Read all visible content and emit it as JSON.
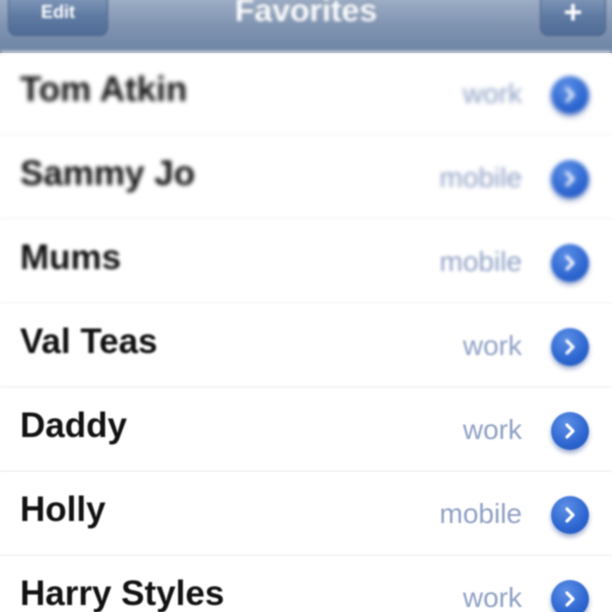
{
  "navbar": {
    "edit_label": "Edit",
    "title": "Favorites",
    "add_label": "+"
  },
  "favorites": [
    {
      "name": "Tom Atkin",
      "type": "work"
    },
    {
      "name": "Sammy Jo",
      "type": "mobile"
    },
    {
      "name": "Mums",
      "type": "mobile"
    },
    {
      "name": "Val Teas",
      "type": "work"
    },
    {
      "name": "Daddy",
      "type": "work"
    },
    {
      "name": "Holly",
      "type": "mobile"
    },
    {
      "name": "Harry Styles",
      "type": "work"
    }
  ],
  "icons": {
    "detail": "chevron-right-circle-icon"
  },
  "colors": {
    "navbar": "#8296b3",
    "label": "#8ea0c4",
    "disclosure": "#2d66d0"
  }
}
